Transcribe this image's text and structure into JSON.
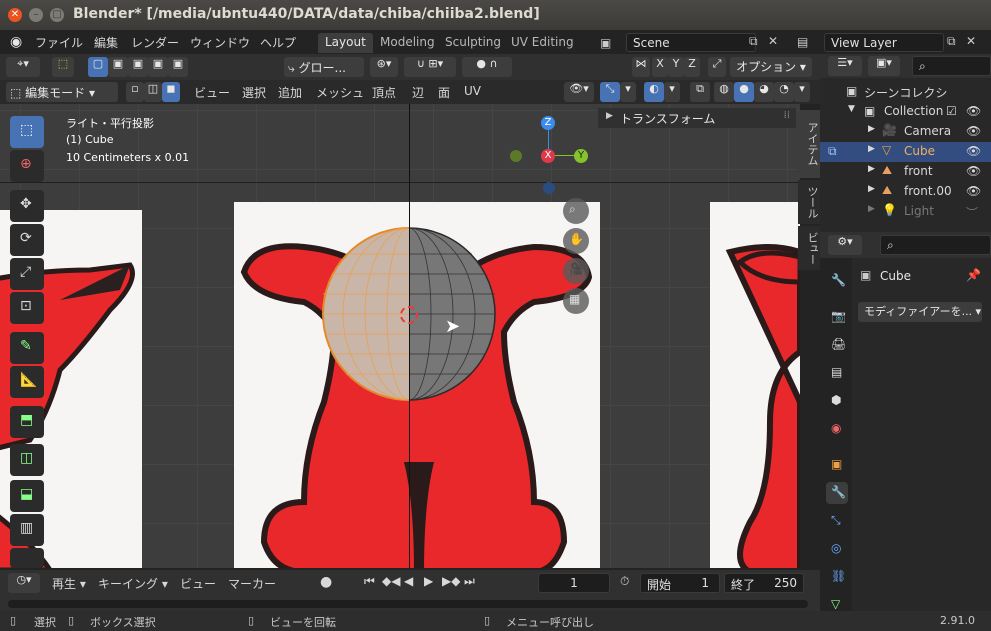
{
  "window": {
    "title": "Blender* [/media/ubntu440/DATA/data/chiba/chiiba2.blend]"
  },
  "menu": {
    "items": [
      "ファイル",
      "編集",
      "レンダー",
      "ウィンドウ",
      "ヘルプ"
    ]
  },
  "workspaces": {
    "tabs": [
      "Layout",
      "Modeling",
      "Sculpting",
      "UV Editing"
    ],
    "active": "Layout"
  },
  "scene": {
    "name": "Scene"
  },
  "view_layer": {
    "name": "View Layer"
  },
  "header": {
    "transform_orientation": "グロー...",
    "options_label": "オプション",
    "axes": [
      "X",
      "Y",
      "Z"
    ],
    "mode": "編集モード",
    "view_menu": [
      "ビュー",
      "選択",
      "追加",
      "メッシュ",
      "頂点",
      "辺",
      "面",
      "UV"
    ]
  },
  "viewport": {
    "info_line1": "ライト・平行投影",
    "info_line2": "(1) Cube",
    "info_line3": "10 Centimeters x 0.01",
    "gizmo_axes": {
      "z": "Z",
      "x": "X",
      "y": "Y"
    },
    "npanel_title": "トランスフォーム",
    "side_tabs": [
      "アイテム",
      "ツール",
      "ビュー"
    ]
  },
  "outliner": {
    "title": "シーンコレクシ",
    "rows": [
      {
        "name": "Collection"
      },
      {
        "name": "Camera"
      },
      {
        "name": "Cube"
      },
      {
        "name": "front"
      },
      {
        "name": "front.00"
      },
      {
        "name": "Light"
      }
    ]
  },
  "properties": {
    "object_name": "Cube",
    "modifier_button": "モディファイアーを..."
  },
  "timeline": {
    "playback": "再生",
    "keying": "キーイング",
    "view": "ビュー",
    "marker": "マーカー",
    "current_frame": "1",
    "start_label": "開始",
    "start_frame": "1",
    "end_label": "終了",
    "end_frame": "250"
  },
  "statusbar": {
    "select": "選択",
    "box_select": "ボックス選択",
    "rotate_view": "ビューを回転",
    "call_menu": "メニュー呼び出し",
    "version": "2.91.0"
  },
  "colors": {
    "accent_blue": "#4772b3",
    "x_axis": "#e0384b",
    "y_axis": "#84c32a",
    "z_axis": "#3b8ded",
    "character_red": "#e8282b"
  }
}
